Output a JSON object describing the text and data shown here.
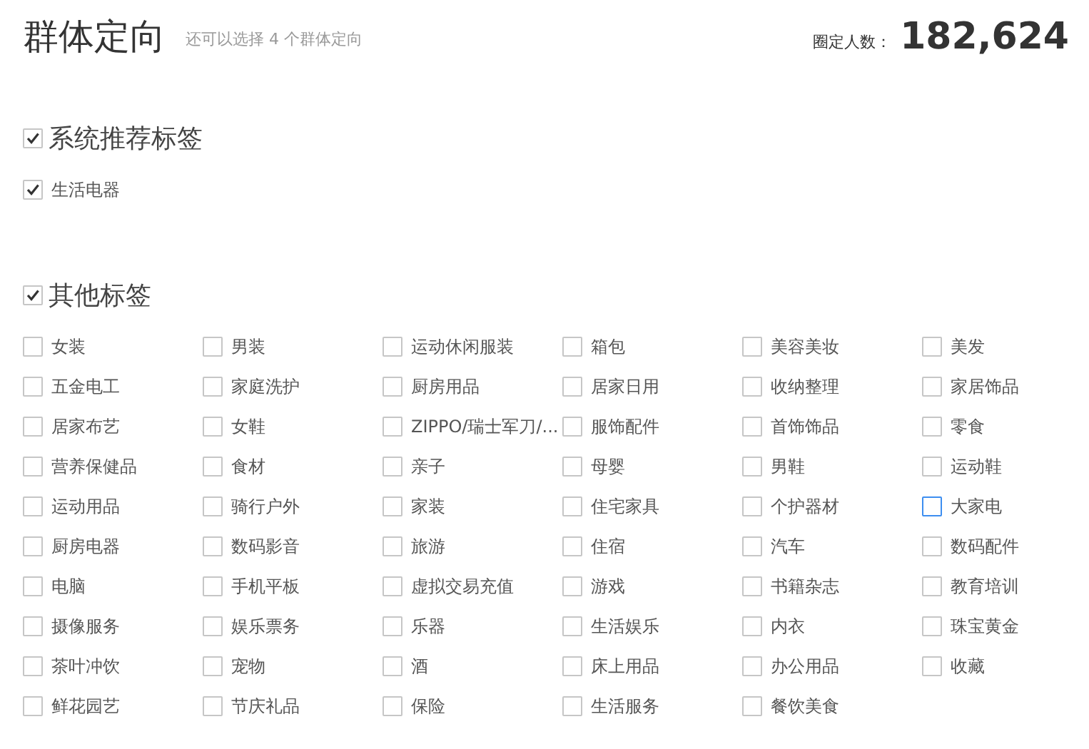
{
  "header": {
    "title": "群体定向",
    "hint": "还可以选择 4 个群体定向",
    "count_label": "圈定人数：",
    "count": "182,624"
  },
  "sections": [
    {
      "title": "系统推荐标签",
      "checked": true,
      "items": [
        {
          "label": "生活电器",
          "checked": true,
          "focused": false
        }
      ]
    },
    {
      "title": "其他标签",
      "checked": true,
      "items": [
        {
          "label": "女装",
          "checked": false,
          "focused": false
        },
        {
          "label": "男装",
          "checked": false,
          "focused": false
        },
        {
          "label": "运动休闲服装",
          "checked": false,
          "focused": false
        },
        {
          "label": "箱包",
          "checked": false,
          "focused": false
        },
        {
          "label": "美容美妆",
          "checked": false,
          "focused": false
        },
        {
          "label": "美发",
          "checked": false,
          "focused": false
        },
        {
          "label": "五金电工",
          "checked": false,
          "focused": false
        },
        {
          "label": "家庭洗护",
          "checked": false,
          "focused": false
        },
        {
          "label": "厨房用品",
          "checked": false,
          "focused": false
        },
        {
          "label": "居家日用",
          "checked": false,
          "focused": false
        },
        {
          "label": "收纳整理",
          "checked": false,
          "focused": false
        },
        {
          "label": "家居饰品",
          "checked": false,
          "focused": false
        },
        {
          "label": "居家布艺",
          "checked": false,
          "focused": false
        },
        {
          "label": "女鞋",
          "checked": false,
          "focused": false
        },
        {
          "label": "ZIPPO/瑞士军刀/...",
          "checked": false,
          "focused": false
        },
        {
          "label": "服饰配件",
          "checked": false,
          "focused": false
        },
        {
          "label": "首饰饰品",
          "checked": false,
          "focused": false
        },
        {
          "label": "零食",
          "checked": false,
          "focused": false
        },
        {
          "label": "营养保健品",
          "checked": false,
          "focused": false
        },
        {
          "label": "食材",
          "checked": false,
          "focused": false
        },
        {
          "label": "亲子",
          "checked": false,
          "focused": false
        },
        {
          "label": "母婴",
          "checked": false,
          "focused": false
        },
        {
          "label": "男鞋",
          "checked": false,
          "focused": false
        },
        {
          "label": "运动鞋",
          "checked": false,
          "focused": false
        },
        {
          "label": "运动用品",
          "checked": false,
          "focused": false
        },
        {
          "label": "骑行户外",
          "checked": false,
          "focused": false
        },
        {
          "label": "家装",
          "checked": false,
          "focused": false
        },
        {
          "label": "住宅家具",
          "checked": false,
          "focused": false
        },
        {
          "label": "个护器材",
          "checked": false,
          "focused": false
        },
        {
          "label": "大家电",
          "checked": false,
          "focused": true
        },
        {
          "label": "厨房电器",
          "checked": false,
          "focused": false
        },
        {
          "label": "数码影音",
          "checked": false,
          "focused": false
        },
        {
          "label": "旅游",
          "checked": false,
          "focused": false
        },
        {
          "label": "住宿",
          "checked": false,
          "focused": false
        },
        {
          "label": "汽车",
          "checked": false,
          "focused": false
        },
        {
          "label": "数码配件",
          "checked": false,
          "focused": false
        },
        {
          "label": "电脑",
          "checked": false,
          "focused": false
        },
        {
          "label": "手机平板",
          "checked": false,
          "focused": false
        },
        {
          "label": "虚拟交易充值",
          "checked": false,
          "focused": false
        },
        {
          "label": "游戏",
          "checked": false,
          "focused": false
        },
        {
          "label": "书籍杂志",
          "checked": false,
          "focused": false
        },
        {
          "label": "教育培训",
          "checked": false,
          "focused": false
        },
        {
          "label": "摄像服务",
          "checked": false,
          "focused": false
        },
        {
          "label": "娱乐票务",
          "checked": false,
          "focused": false
        },
        {
          "label": "乐器",
          "checked": false,
          "focused": false
        },
        {
          "label": "生活娱乐",
          "checked": false,
          "focused": false
        },
        {
          "label": "内衣",
          "checked": false,
          "focused": false
        },
        {
          "label": "珠宝黄金",
          "checked": false,
          "focused": false
        },
        {
          "label": "茶叶冲饮",
          "checked": false,
          "focused": false
        },
        {
          "label": "宠物",
          "checked": false,
          "focused": false
        },
        {
          "label": "酒",
          "checked": false,
          "focused": false
        },
        {
          "label": "床上用品",
          "checked": false,
          "focused": false
        },
        {
          "label": "办公用品",
          "checked": false,
          "focused": false
        },
        {
          "label": "收藏",
          "checked": false,
          "focused": false
        },
        {
          "label": "鲜花园艺",
          "checked": false,
          "focused": false
        },
        {
          "label": "节庆礼品",
          "checked": false,
          "focused": false
        },
        {
          "label": "保险",
          "checked": false,
          "focused": false
        },
        {
          "label": "生活服务",
          "checked": false,
          "focused": false
        },
        {
          "label": "餐饮美食",
          "checked": false,
          "focused": false
        }
      ]
    }
  ]
}
